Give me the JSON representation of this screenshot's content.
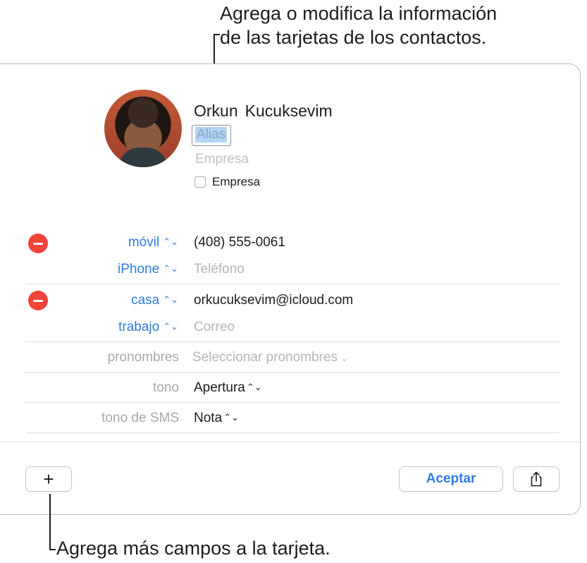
{
  "callouts": {
    "top_line1": "Agrega o modifica la información",
    "top_line2": "de las tarjetas de los contactos.",
    "bottom": "Agrega más campos a la tarjeta."
  },
  "contact": {
    "first_name": "Orkun",
    "last_name": "Kucuksevim",
    "alias_placeholder": "Alias",
    "company_placeholder": "Empresa",
    "company_checkbox_label": "Empresa",
    "company_checkbox_checked": false
  },
  "phones": [
    {
      "label": "móvil",
      "value": "(408) 555-0061",
      "is_placeholder": false
    },
    {
      "label": "iPhone",
      "value": "Teléfono",
      "is_placeholder": true
    }
  ],
  "emails": [
    {
      "label": "casa",
      "value": "orkucuksevim@icloud.com",
      "is_placeholder": false
    },
    {
      "label": "trabajo",
      "value": "Correo",
      "is_placeholder": true
    }
  ],
  "pronouns": {
    "label": "pronombres",
    "value": "Seleccionar pronombres"
  },
  "ringtone": {
    "label": "tono",
    "value": "Apertura"
  },
  "text_tone": {
    "label": "tono de SMS",
    "value": "Nota"
  },
  "footer": {
    "add_label": "+",
    "accept_label": "Aceptar"
  },
  "colors": {
    "accent": "#2f7bde",
    "remove": "#f0433a"
  },
  "icons": {
    "up_down": "chevron-up-down-icon",
    "down": "chevron-down-icon",
    "share": "share-icon",
    "remove": "remove-icon"
  }
}
